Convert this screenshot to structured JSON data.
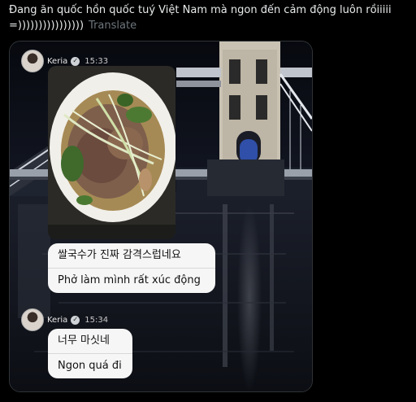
{
  "post": {
    "text": "Đang ăn quốc hồn quốc tuý Việt Nam mà ngon đến cảm động luôn rồiiiii =))))))))))))))))",
    "translate_label": "Translate"
  },
  "stories": [
    {
      "username": "Keria",
      "time": "15:33",
      "original": "쌀국수가 진짜 감격스럽네요",
      "translation": "Phở làm mình rất xúc động"
    },
    {
      "username": "Keria",
      "time": "15:34",
      "original": "너무 마싯네",
      "translation": "Ngon quá đi"
    }
  ],
  "icons": {
    "verified": "verified-badge-icon"
  },
  "colors": {
    "page_background": "#000000",
    "post_text": "#e7e9ea",
    "translate_link": "#6e767d",
    "bubble_background": "#f6f6f6"
  }
}
